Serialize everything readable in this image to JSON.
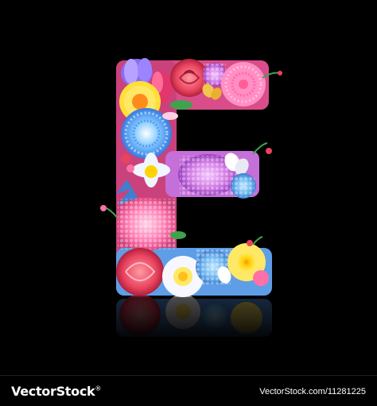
{
  "illustration": {
    "glyph": "E",
    "motif": "floral letter with reflection",
    "background_color": "#000000"
  },
  "footer": {
    "brand_name": "VectorStock",
    "brand_mark": "®",
    "image_id_text": "VectorStock.com/11281225"
  },
  "palette": {
    "pink": "#ff6fa8",
    "rose": "#e8435e",
    "yellow": "#ffd400",
    "blue": "#4db3ff",
    "lilac": "#c070e8",
    "white": "#f7f7ff",
    "leaf": "#3fa34d"
  }
}
